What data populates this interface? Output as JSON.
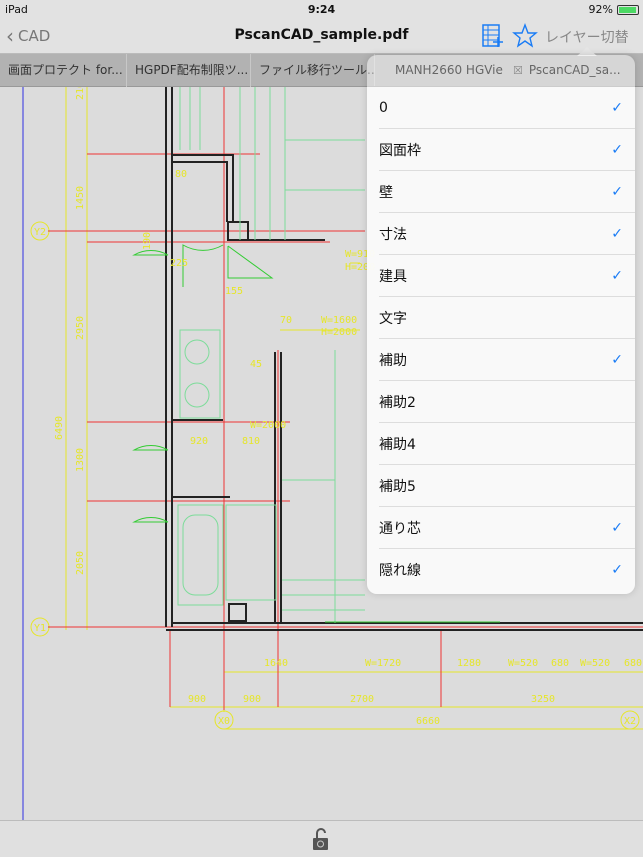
{
  "status_bar": {
    "device": "iPad",
    "time": "9:24",
    "battery": "92%",
    "battery_level": 0.92
  },
  "nav": {
    "back_label": "CAD",
    "title": "PscanCAD_sample.pdf",
    "layer_button": "レイヤー切替",
    "icons": [
      "grid-add-icon",
      "star-icon"
    ]
  },
  "tabs": [
    {
      "label": "画面プロテクト for..."
    },
    {
      "label": "HGPDF配布制限ツ..."
    },
    {
      "label": "ファイル移行ツール..."
    },
    {
      "label": "MANH2660 HGVie..."
    },
    {
      "label": "PscanCAD_sa..."
    }
  ],
  "layers": [
    {
      "label": "0",
      "checked": true
    },
    {
      "label": "図面枠",
      "checked": true
    },
    {
      "label": "壁",
      "checked": true
    },
    {
      "label": "寸法",
      "checked": true
    },
    {
      "label": "建具",
      "checked": true
    },
    {
      "label": "文字",
      "checked": false
    },
    {
      "label": "補助",
      "checked": true
    },
    {
      "label": "補助2",
      "checked": false
    },
    {
      "label": "補助4",
      "checked": false
    },
    {
      "label": "補助5",
      "checked": false
    },
    {
      "label": "通り芯",
      "checked": true
    },
    {
      "label": "隠れ線",
      "checked": true
    }
  ],
  "checkmark": "✓",
  "accent": "#1a7cf5",
  "drawing": {
    "grid_labels": {
      "y2": "Y2",
      "y1": "Y1",
      "x0": "X0",
      "x2": "X2"
    },
    "dims_vertical": [
      "210",
      "1450",
      "2950",
      "6490",
      "1300",
      "2050"
    ],
    "dims_row1": [
      "1640",
      "W=1720",
      "1280",
      "W=520",
      "680",
      "W=520",
      "680"
    ],
    "dims_row2": [
      "900",
      "900",
      "2700",
      "3250"
    ],
    "dims_total": "6660",
    "notes": [
      "W=1600",
      "H=2000",
      "W=910",
      "H=200",
      "225",
      "155",
      "810",
      "920",
      "70",
      "45",
      "80",
      "190",
      "W=2000"
    ]
  },
  "toolbar": {
    "lock_icon": "unlock-icon"
  }
}
